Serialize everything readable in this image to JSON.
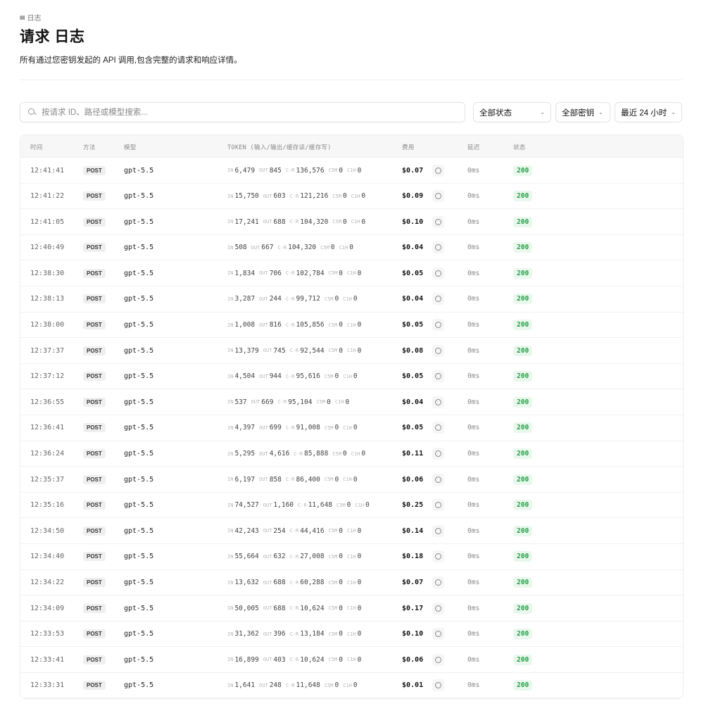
{
  "breadcrumb": {
    "icon": "document-icon",
    "label": "日志"
  },
  "page": {
    "title": "请求 日志",
    "subtitle": "所有通过您密钥发起的 API 调用,包含完整的请求和响应详情。"
  },
  "search": {
    "placeholder": "按请求 ID、路径或模型搜索..."
  },
  "filters": {
    "status": {
      "label": "全部状态",
      "icon": "chevron-down-icon"
    },
    "key": {
      "label": "全部密钥",
      "icon": "chevron-down-icon"
    },
    "time": {
      "label": "最近 24 小时",
      "icon": "chevron-down-icon"
    }
  },
  "table": {
    "headers": {
      "time": "时间",
      "method": "方法",
      "model": "模型",
      "token": "TOKEN (输入/输出/缓存读/缓存写)",
      "cost": "费用",
      "latency": "延迟",
      "status": "状态"
    },
    "token_labels": {
      "in": "IN",
      "out": "OUT",
      "cr": "C-R",
      "c5m": "C5M",
      "c1h": "C1H"
    },
    "status_color": "#22a046",
    "rows": [
      {
        "time": "12:41:41",
        "method": "POST",
        "model": "gpt-5.5",
        "in": "6,479",
        "out": "845",
        "cr": "136,576",
        "c5m": "0",
        "c1h": "0",
        "cost": "$0.07",
        "latency": "0ms",
        "status": "200"
      },
      {
        "time": "12:41:22",
        "method": "POST",
        "model": "gpt-5.5",
        "in": "15,750",
        "out": "603",
        "cr": "121,216",
        "c5m": "0",
        "c1h": "0",
        "cost": "$0.09",
        "latency": "0ms",
        "status": "200"
      },
      {
        "time": "12:41:05",
        "method": "POST",
        "model": "gpt-5.5",
        "in": "17,241",
        "out": "688",
        "cr": "104,320",
        "c5m": "0",
        "c1h": "0",
        "cost": "$0.10",
        "latency": "0ms",
        "status": "200"
      },
      {
        "time": "12:40:49",
        "method": "POST",
        "model": "gpt-5.5",
        "in": "508",
        "out": "667",
        "cr": "104,320",
        "c5m": "0",
        "c1h": "0",
        "cost": "$0.04",
        "latency": "0ms",
        "status": "200"
      },
      {
        "time": "12:38:30",
        "method": "POST",
        "model": "gpt-5.5",
        "in": "1,834",
        "out": "706",
        "cr": "102,784",
        "c5m": "0",
        "c1h": "0",
        "cost": "$0.05",
        "latency": "0ms",
        "status": "200"
      },
      {
        "time": "12:38:13",
        "method": "POST",
        "model": "gpt-5.5",
        "in": "3,287",
        "out": "244",
        "cr": "99,712",
        "c5m": "0",
        "c1h": "0",
        "cost": "$0.04",
        "latency": "0ms",
        "status": "200"
      },
      {
        "time": "12:38:00",
        "method": "POST",
        "model": "gpt-5.5",
        "in": "1,008",
        "out": "816",
        "cr": "105,856",
        "c5m": "0",
        "c1h": "0",
        "cost": "$0.05",
        "latency": "0ms",
        "status": "200"
      },
      {
        "time": "12:37:37",
        "method": "POST",
        "model": "gpt-5.5",
        "in": "13,379",
        "out": "745",
        "cr": "92,544",
        "c5m": "0",
        "c1h": "0",
        "cost": "$0.08",
        "latency": "0ms",
        "status": "200"
      },
      {
        "time": "12:37:12",
        "method": "POST",
        "model": "gpt-5.5",
        "in": "4,504",
        "out": "944",
        "cr": "95,616",
        "c5m": "0",
        "c1h": "0",
        "cost": "$0.05",
        "latency": "0ms",
        "status": "200"
      },
      {
        "time": "12:36:55",
        "method": "POST",
        "model": "gpt-5.5",
        "in": "537",
        "out": "669",
        "cr": "95,104",
        "c5m": "0",
        "c1h": "0",
        "cost": "$0.04",
        "latency": "0ms",
        "status": "200"
      },
      {
        "time": "12:36:41",
        "method": "POST",
        "model": "gpt-5.5",
        "in": "4,397",
        "out": "699",
        "cr": "91,008",
        "c5m": "0",
        "c1h": "0",
        "cost": "$0.05",
        "latency": "0ms",
        "status": "200"
      },
      {
        "time": "12:36:24",
        "method": "POST",
        "model": "gpt-5.5",
        "in": "5,295",
        "out": "4,616",
        "cr": "85,888",
        "c5m": "0",
        "c1h": "0",
        "cost": "$0.11",
        "latency": "0ms",
        "status": "200"
      },
      {
        "time": "12:35:37",
        "method": "POST",
        "model": "gpt-5.5",
        "in": "6,197",
        "out": "858",
        "cr": "86,400",
        "c5m": "0",
        "c1h": "0",
        "cost": "$0.06",
        "latency": "0ms",
        "status": "200"
      },
      {
        "time": "12:35:16",
        "method": "POST",
        "model": "gpt-5.5",
        "in": "74,527",
        "out": "1,160",
        "cr": "11,648",
        "c5m": "0",
        "c1h": "0",
        "cost": "$0.25",
        "latency": "0ms",
        "status": "200"
      },
      {
        "time": "12:34:50",
        "method": "POST",
        "model": "gpt-5.5",
        "in": "42,243",
        "out": "254",
        "cr": "44,416",
        "c5m": "0",
        "c1h": "0",
        "cost": "$0.14",
        "latency": "0ms",
        "status": "200"
      },
      {
        "time": "12:34:40",
        "method": "POST",
        "model": "gpt-5.5",
        "in": "55,664",
        "out": "632",
        "cr": "27,008",
        "c5m": "0",
        "c1h": "0",
        "cost": "$0.18",
        "latency": "0ms",
        "status": "200"
      },
      {
        "time": "12:34:22",
        "method": "POST",
        "model": "gpt-5.5",
        "in": "13,632",
        "out": "688",
        "cr": "60,288",
        "c5m": "0",
        "c1h": "0",
        "cost": "$0.07",
        "latency": "0ms",
        "status": "200"
      },
      {
        "time": "12:34:09",
        "method": "POST",
        "model": "gpt-5.5",
        "in": "50,005",
        "out": "688",
        "cr": "10,624",
        "c5m": "0",
        "c1h": "0",
        "cost": "$0.17",
        "latency": "0ms",
        "status": "200"
      },
      {
        "time": "12:33:53",
        "method": "POST",
        "model": "gpt-5.5",
        "in": "31,362",
        "out": "396",
        "cr": "13,184",
        "c5m": "0",
        "c1h": "0",
        "cost": "$0.10",
        "latency": "0ms",
        "status": "200"
      },
      {
        "time": "12:33:41",
        "method": "POST",
        "model": "gpt-5.5",
        "in": "16,899",
        "out": "403",
        "cr": "10,624",
        "c5m": "0",
        "c1h": "0",
        "cost": "$0.06",
        "latency": "0ms",
        "status": "200"
      },
      {
        "time": "12:33:31",
        "method": "POST",
        "model": "gpt-5.5",
        "in": "1,641",
        "out": "248",
        "cr": "11,648",
        "c5m": "0",
        "c1h": "0",
        "cost": "$0.01",
        "latency": "0ms",
        "status": "200"
      }
    ]
  }
}
